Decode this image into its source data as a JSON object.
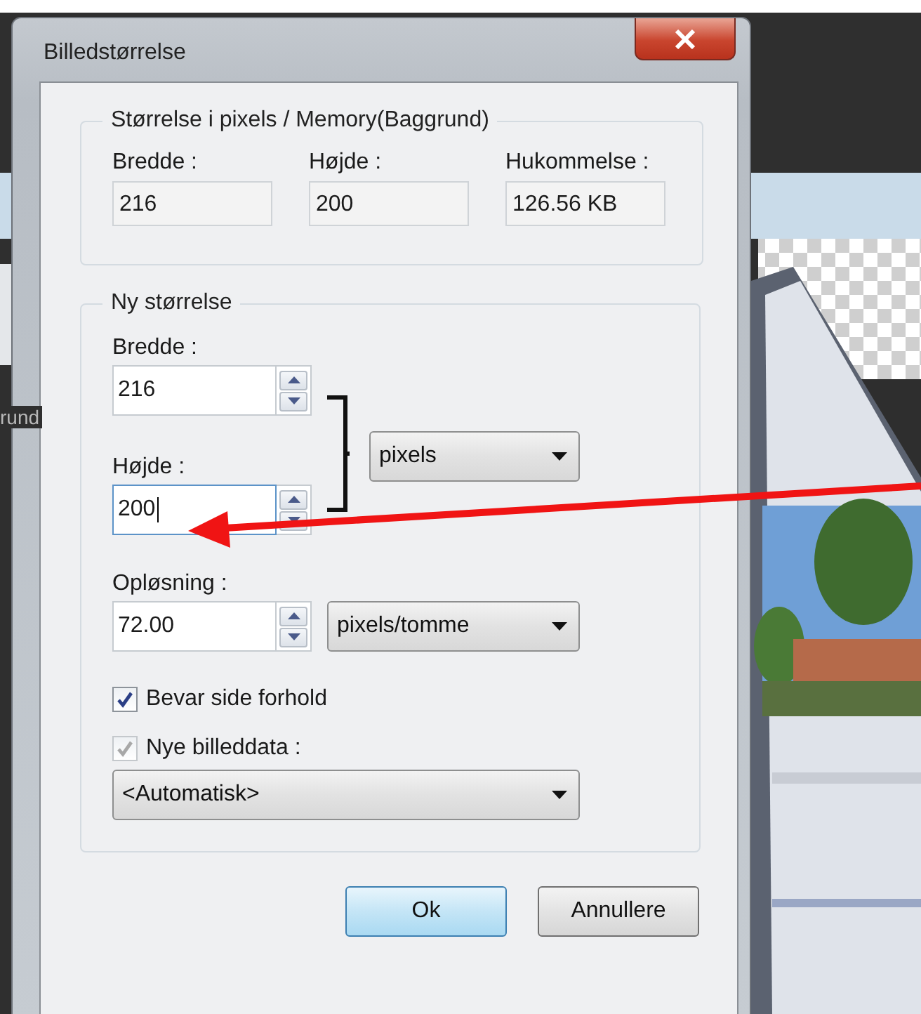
{
  "background": {
    "layer_label": "rund"
  },
  "window": {
    "title": "Billedstørrelse"
  },
  "current_size": {
    "title": "Størrelse i pixels / Memory(Baggrund)",
    "fields": [
      {
        "label": "Bredde :",
        "value": "216"
      },
      {
        "label": "Højde :",
        "value": "200"
      },
      {
        "label": "Hukommelse :",
        "value": "126.56 KB"
      }
    ]
  },
  "new_size": {
    "title": "Ny størrelse",
    "width": {
      "label": "Bredde :",
      "value": "216",
      "focused": false
    },
    "height": {
      "label": "Højde :",
      "value": "200",
      "focused": true
    },
    "unit": {
      "value": "pixels"
    },
    "resolution": {
      "label": "Opløsning :",
      "value": "72.00",
      "focused": false
    },
    "resolution_unit": {
      "value": "pixels/tomme"
    },
    "checkboxes": [
      {
        "label": "Bevar side forhold",
        "checked": true,
        "disabled": false
      },
      {
        "label": "Nye billeddata :",
        "checked": true,
        "disabled": true
      }
    ],
    "resample": {
      "value": "<Automatisk>"
    }
  },
  "buttons": [
    {
      "label": "Ok",
      "default": true
    },
    {
      "label": "Annullere",
      "default": false
    }
  ]
}
